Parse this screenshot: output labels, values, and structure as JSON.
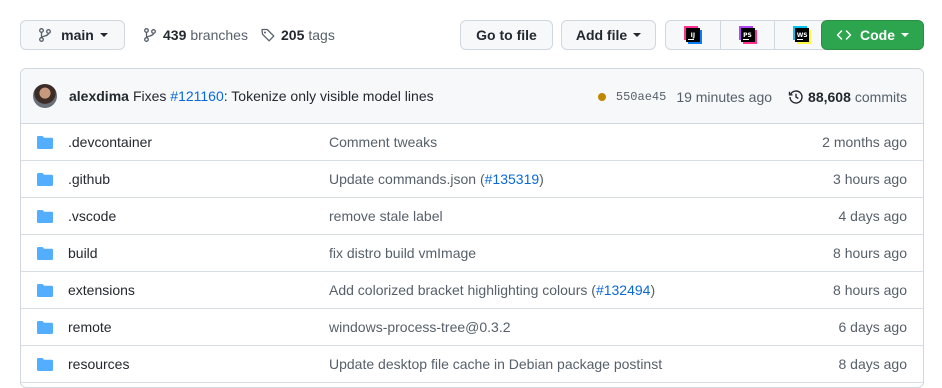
{
  "toolbar": {
    "branch": "main",
    "branches_count": "439",
    "branches_label": "branches",
    "tags_count": "205",
    "tags_label": "tags",
    "go_to_file": "Go to file",
    "add_file": "Add file",
    "ide_buttons": [
      "IJ",
      "PS",
      "WS"
    ],
    "code": "Code"
  },
  "commit": {
    "author": "alexdima",
    "message_prefix": "Fixes",
    "issue": "#121160",
    "message_suffix": ": Tokenize only visible model lines",
    "sha": "550ae45",
    "time": "19 minutes ago",
    "commits_count": "88,608",
    "commits_label": "commits"
  },
  "files": [
    {
      "name": ".devcontainer",
      "msg": "Comment tweaks",
      "link": "",
      "msg_end": "",
      "time": "2 months ago"
    },
    {
      "name": ".github",
      "msg": "Update commands.json (",
      "link": "#135319",
      "msg_end": ")",
      "time": "3 hours ago"
    },
    {
      "name": ".vscode",
      "msg": "remove stale label",
      "link": "",
      "msg_end": "",
      "time": "4 days ago"
    },
    {
      "name": "build",
      "msg": "fix distro build vmImage",
      "link": "",
      "msg_end": "",
      "time": "8 hours ago"
    },
    {
      "name": "extensions",
      "msg": "Add colorized bracket highlighting colours (",
      "link": "#132494",
      "msg_end": ")",
      "time": "8 hours ago"
    },
    {
      "name": "remote",
      "msg": "windows-process-tree@0.3.2",
      "link": "",
      "msg_end": "",
      "time": "6 days ago"
    },
    {
      "name": "resources",
      "msg": "Update desktop file cache in Debian package postinst",
      "link": "",
      "msg_end": "",
      "time": "8 days ago"
    }
  ],
  "colors": {
    "folder": "#54aeff",
    "link": "#0969da",
    "code_button": "#2da44e",
    "status_pending": "#bf8700"
  }
}
